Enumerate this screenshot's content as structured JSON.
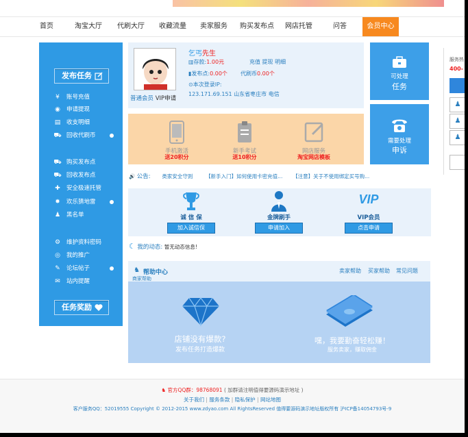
{
  "nav": {
    "items": [
      "首页",
      "淘宝大厅",
      "代刷大厅",
      "收藏流量",
      "卖家服务",
      "购买发布点",
      "网店托管",
      "问答",
      "会员中心"
    ],
    "active_index": 8
  },
  "sidebar": {
    "publish_label": "发布任务",
    "group1": [
      "账号充值",
      "申请提现",
      "收支明细",
      "回收代刷币"
    ],
    "group2": [
      "购买发布点",
      "回收发布点",
      "安全极速托管",
      "欢乐猜地雷",
      "黑名单"
    ],
    "group3": [
      "维护资料密码",
      "我的推广",
      "论坛帖子",
      "站内提醒"
    ],
    "reward_label": "任务奖励"
  },
  "profile": {
    "username": "乞丐",
    "honorific": "先生",
    "deposit_label": "存款:",
    "deposit_value": "1.00元",
    "links": "充值 提现 明细",
    "points_label": "发布点:",
    "points_value": "0.00个",
    "coin_label": "代刷币",
    "coin_value": "0.00个",
    "login_ip_label": "本次登录IP:",
    "login_ip": "123.171.69.151 山东省枣庄市 电信",
    "member_level": "普通会员",
    "vip_apply": "VIP申请"
  },
  "hot_tasks": [
    {
      "label": "手机激活",
      "points": "送20积分"
    },
    {
      "label": "新手考试",
      "points": "送10积分"
    },
    {
      "label": "网店服务",
      "points": "淘宝网店模板"
    }
  ],
  "tiles": [
    {
      "line1": "可处理",
      "line2": "任务"
    },
    {
      "line1": "需要处理",
      "line2": "申诉"
    }
  ],
  "notice": {
    "label": "公告:",
    "items": [
      "类家安全守则",
      "【新手入门】如何使用卡密充值...",
      "【注意】关于不使用绑定买号购..."
    ]
  },
  "services": [
    {
      "title": "诚 信 保",
      "button": "加入诚信保"
    },
    {
      "title": "金牌刷手",
      "button": "申请加入"
    },
    {
      "title": "VIP会员",
      "button": "点击申请",
      "logo": "VIP"
    }
  ],
  "dynamic": {
    "label": "我的动态:",
    "text": "暂无动态信息!"
  },
  "help": {
    "title": "帮助中心",
    "subtitle": "商家帮助",
    "links": [
      "卖家帮助",
      "买家帮助",
      "常见问题"
    ],
    "left_main": "店铺没有爆款?",
    "left_sub": "发布任务打造爆款",
    "right_main": "嘿，我要勤奋轻松赚！",
    "right_sub": "服务卖家，赚取佣金"
  },
  "right_panel": {
    "title": "服务热",
    "value": "400-"
  },
  "footer": {
    "qq_label": "官方QQ群：",
    "qq_value": "98768091",
    "qq_note": "( 加群请注明值得要源码演示地址 )",
    "links": [
      "关于我们",
      "服务条款",
      "隐私保护",
      "网站地图"
    ],
    "copyright": "客户服务QQ：52019555 Copyright © 2012-2015 www.zdyao.com All RightsReserved 值得要源码演示地址版权所有  沪ICP备14054793号-9"
  },
  "colors": {
    "primary": "#2f9ae4",
    "accent": "#f7891f",
    "panel": "#e9f2fb",
    "warm": "#fbd6a8"
  }
}
